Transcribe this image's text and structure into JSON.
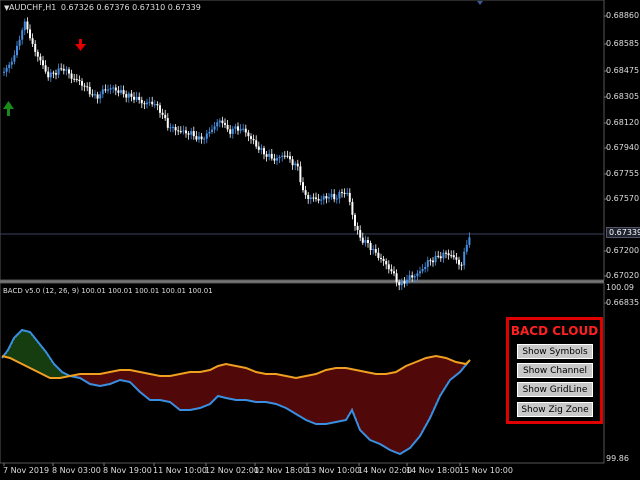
{
  "header": {
    "symbol": "AUDCHF,H1",
    "ohlc": "0.67326 0.67376 0.67310 0.67339",
    "dropdown_icon": "triangle-down-icon"
  },
  "indicator": {
    "info": "BACD v5.0 (12, 26, 9) 100.01 100.01 100.01 100.01 100.01"
  },
  "price_axis": {
    "labels": [
      "0.68860",
      "0.68585",
      "0.68475",
      "0.68305",
      "0.68120",
      "0.67940",
      "0.67755",
      "0.67570",
      "0.67200",
      "0.67020",
      "0.66835"
    ],
    "current": "0.67339"
  },
  "indicator_axis": {
    "top": "100.09",
    "bottom": "99.86"
  },
  "time_axis": {
    "labels": [
      "7 Nov 2019",
      "8 Nov 03:00",
      "8 Nov 19:00",
      "11 Nov 10:00",
      "12 Nov 02:00",
      "12 Nov 18:00",
      "13 Nov 10:00",
      "14 Nov 02:00",
      "14 Nov 18:00",
      "15 Nov 10:00"
    ]
  },
  "panel": {
    "title": "BACD CLOUD",
    "buttons": [
      "Show Symbols",
      "Show Channel",
      "Show GridLine",
      "Show Zig Zone"
    ]
  },
  "colors": {
    "bull_candle": "#4a90e2",
    "bear_candle": "#ffffff",
    "sell_arrow": "#e00000",
    "buy_arrow": "#1a8a1a",
    "fast_line": "#3a8fe0",
    "slow_line": "#f0a020",
    "cloud_bull": "#2a7a20",
    "cloud_bear": "#a01010",
    "panel_border": "#e00000"
  }
}
